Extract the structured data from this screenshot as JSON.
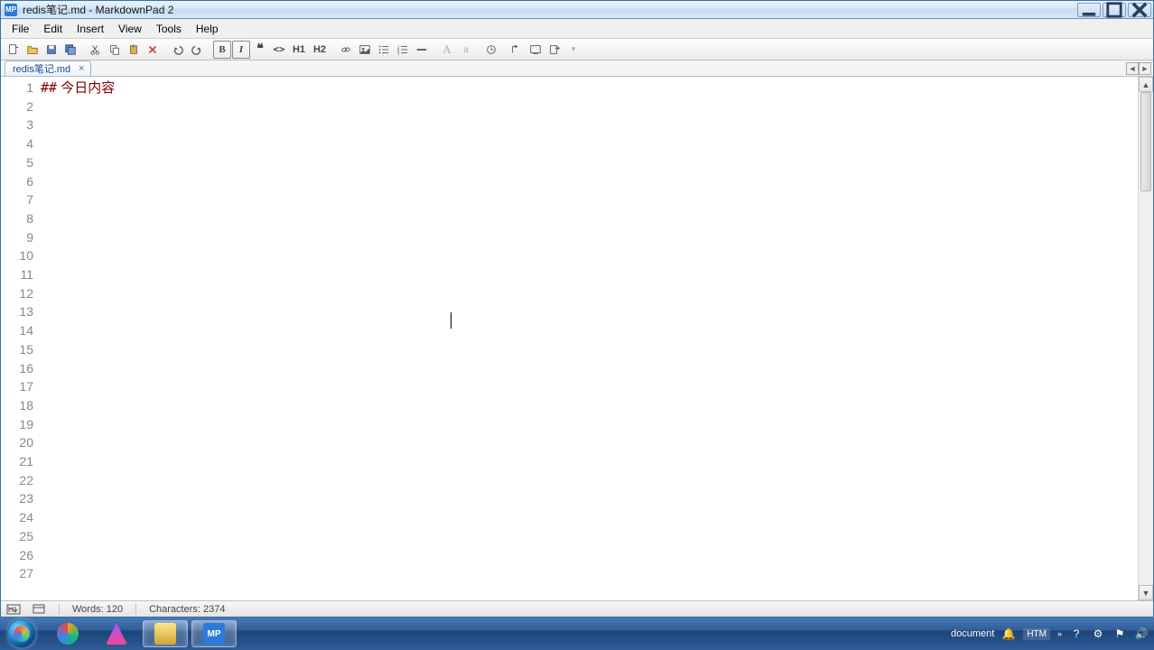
{
  "window": {
    "title": "redis笔记.md - MarkdownPad 2",
    "app_icon_text": "MP"
  },
  "menu": {
    "items": [
      "File",
      "Edit",
      "Insert",
      "View",
      "Tools",
      "Help"
    ]
  },
  "tab": {
    "label": "redis笔记.md"
  },
  "editor": {
    "line1_hash": "##",
    "line1_text": " 今日内容",
    "line_numbers": [
      "1",
      "2",
      "3",
      "4",
      "5",
      "6",
      "7",
      "8",
      "9",
      "10",
      "11",
      "12",
      "13",
      "14",
      "15",
      "16",
      "17",
      "18",
      "19",
      "20",
      "21",
      "22",
      "23",
      "24",
      "25",
      "26",
      "27"
    ]
  },
  "status": {
    "words_label": "Words: ",
    "words_value": "120",
    "chars_label": "Characters: ",
    "chars_value": "2374"
  },
  "tray": {
    "document": "document",
    "lang": "HTM"
  }
}
